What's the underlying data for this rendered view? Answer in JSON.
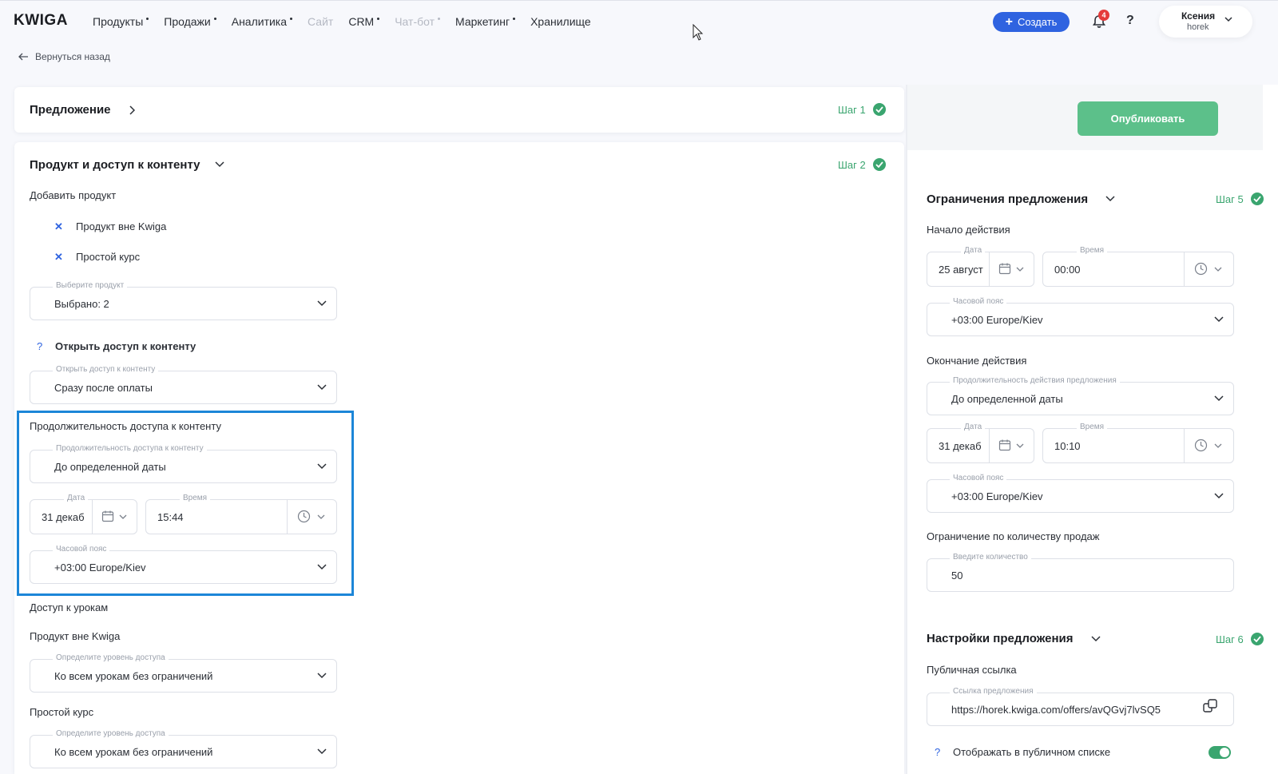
{
  "app": {
    "logo": "KWIGA"
  },
  "nav": {
    "items": [
      {
        "label": "Продукты",
        "dot": true,
        "disabled": false
      },
      {
        "label": "Продажи",
        "dot": true,
        "disabled": false
      },
      {
        "label": "Аналитика",
        "dot": true,
        "disabled": false
      },
      {
        "label": "Сайт",
        "dot": false,
        "disabled": true
      },
      {
        "label": "CRM",
        "dot": true,
        "disabled": false
      },
      {
        "label": "Чат-бот",
        "dot": true,
        "disabled": true
      },
      {
        "label": "Маркетинг",
        "dot": true,
        "disabled": false
      },
      {
        "label": "Хранилище",
        "dot": false,
        "disabled": false
      }
    ],
    "create_label": "Создать",
    "notifications_count": "4",
    "help_label": "?",
    "user_name": "Ксения",
    "user_sub": "horek"
  },
  "back_label": "Вернуться назад",
  "offer_card": {
    "title": "Предложение",
    "step": "Шаг 1"
  },
  "product_card": {
    "title": "Продукт и доступ к контенту",
    "step": "Шаг 2",
    "add_product_label": "Добавить продукт",
    "products": [
      "Продукт вне Kwiga",
      "Простой курс"
    ],
    "select_product": {
      "legend": "Выберите продукт",
      "value": "Выбрано: 2"
    },
    "open_access_label": "Открыть доступ к контенту",
    "open_access_field": {
      "legend": "Открыть доступ к контенту",
      "value": "Сразу после оплаты"
    },
    "duration_label": "Продолжительность доступа к контенту",
    "duration_field": {
      "legend": "Продолжительность доступа к контенту",
      "value": "До определенной даты"
    },
    "date_field": {
      "legend": "Дата",
      "value": "31 декаб"
    },
    "time_field": {
      "legend": "Время",
      "value": "15:44"
    },
    "timezone_field": {
      "legend": "Часовой пояс",
      "value": "+03:00 Europe/Kiev"
    },
    "lessons_access_label": "Доступ к урокам",
    "lesson_groups": [
      {
        "title": "Продукт вне Kwiga",
        "legend": "Определите уровень доступа",
        "value": "Ко всем урокам без ограничений"
      },
      {
        "title": "Простой курс",
        "legend": "Определите уровень доступа",
        "value": "Ко всем урокам без ограничений"
      }
    ]
  },
  "publish_label": "Опубликовать",
  "limits_card": {
    "title": "Ограничения предложения",
    "step": "Шаг 5",
    "start_label": "Начало действия",
    "start_date": {
      "legend": "Дата",
      "value": "25 август"
    },
    "start_time": {
      "legend": "Время",
      "value": "00:00"
    },
    "start_tz": {
      "legend": "Часовой пояс",
      "value": "+03:00 Europe/Kiev"
    },
    "end_label": "Окончание действия",
    "end_duration": {
      "legend": "Продолжительность действия предложения",
      "value": "До определенной даты"
    },
    "end_date": {
      "legend": "Дата",
      "value": "31 декаб"
    },
    "end_time": {
      "legend": "Время",
      "value": "10:10"
    },
    "end_tz": {
      "legend": "Часовой пояс",
      "value": "+03:00 Europe/Kiev"
    },
    "sales_limit_label": "Ограничение по количеству продаж",
    "sales_limit_field": {
      "legend": "Введите количество",
      "value": "50"
    }
  },
  "settings_card": {
    "title": "Настройки предложения",
    "step": "Шаг 6",
    "public_link_label": "Публичная ссылка",
    "link_field": {
      "legend": "Ссылка предложения",
      "value": "https://horek.kwiga.com/offers/avQGvj7lvSQ5"
    },
    "show_in_list_label": "Отображать в публичном списке",
    "show_in_list_on": true
  },
  "colors": {
    "accent": "#2f63e0",
    "success": "#3aa56f",
    "publish": "#5cc08a",
    "highlight": "#1c86d8"
  }
}
